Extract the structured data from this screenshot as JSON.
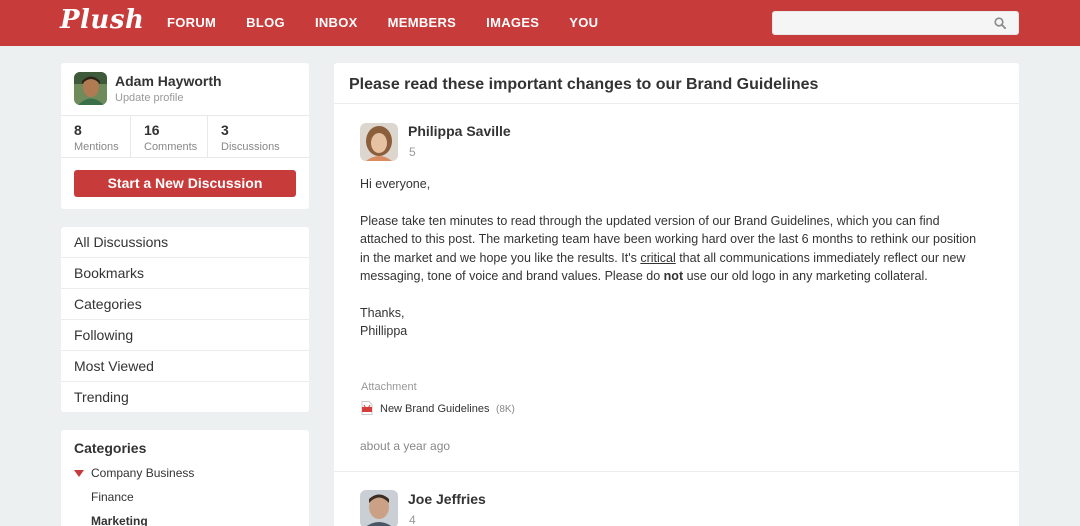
{
  "app": {
    "logo": "Plush"
  },
  "nav": {
    "items": [
      "FORUM",
      "BLOG",
      "INBOX",
      "MEMBERS",
      "IMAGES",
      "YOU"
    ]
  },
  "search": {
    "placeholder": "",
    "icon": "search-icon"
  },
  "profile": {
    "name": "Adam Hayworth",
    "subtitle": "Update profile",
    "stats": [
      {
        "value": "8",
        "label": "Mentions"
      },
      {
        "value": "16",
        "label": "Comments"
      },
      {
        "value": "3",
        "label": "Discussions"
      }
    ],
    "new_discussion_label": "Start a New Discussion"
  },
  "sidebar": {
    "items": [
      "All Discussions",
      "Bookmarks",
      "Categories",
      "Following",
      "Most Viewed",
      "Trending"
    ]
  },
  "categories": {
    "title": "Categories",
    "items": [
      "Company Business",
      "Finance",
      "Marketing"
    ]
  },
  "discussion": {
    "title": "Please read these important changes to our Brand Guidelines",
    "posts": [
      {
        "author": "Philippa Saville",
        "count": "5",
        "greeting": "Hi everyone,",
        "paragraph_before": "Please take ten minutes to read through the updated version of our Brand Guidelines, which you can find attached to this post. The marketing team have been working hard over the last 6 months to rethink our position in the market and we hope you like the results. It's ",
        "emphasis_word": "critical",
        "paragraph_middle": " that all communications immediately reflect our new messaging, tone of voice and brand values. Please do ",
        "bold_word": "not",
        "paragraph_after": " use our old logo in any marketing collateral.",
        "signoff": "Thanks,",
        "signature": "Phillippa",
        "attachment_label": "Attachment",
        "attachment_name": "New Brand Guidelines",
        "attachment_size": "(8K)",
        "time": "about a year ago"
      },
      {
        "author": "Joe Jeffries",
        "count": "4"
      }
    ]
  },
  "colors": {
    "brand_red": "#c83b3b",
    "page_bg": "#ecf0f1"
  }
}
